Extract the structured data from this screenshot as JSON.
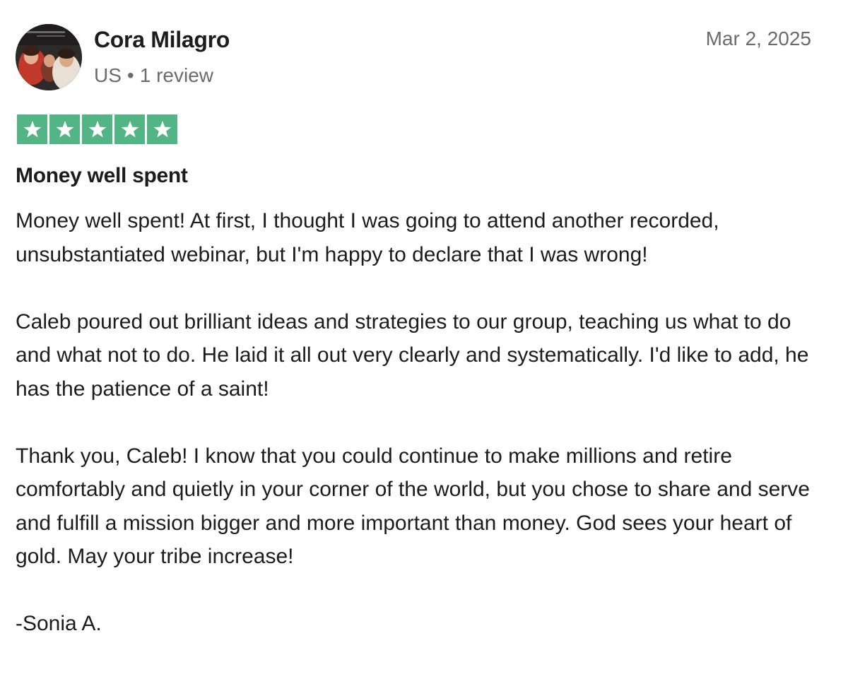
{
  "reviewer": {
    "name": "Cora Milagro",
    "country": "US",
    "separator": "•",
    "review_count": "1 review",
    "avatar_icon": "profile-photo"
  },
  "review": {
    "date": "Mar 2, 2025",
    "rating": 5,
    "rating_max": 5,
    "star_color": "#53b585",
    "title": "Money well spent",
    "paragraphs": [
      "Money well spent! At first, I thought I was going to attend another recorded, unsubstantiated webinar, but I'm happy to declare that I was wrong!",
      "Caleb poured out brilliant ideas and strategies to our group, teaching us what to do and what not to do. He laid it all out very clearly and systematically. I'd like to add, he has the patience of a saint!",
      "Thank you, Caleb! I know that you could continue to make millions and retire comfortably and quietly in your corner of the world, but you chose to share and serve and fulfill a mission bigger and more important than money. God sees your heart of gold. May your tribe increase!",
      "-Sonia A."
    ]
  }
}
